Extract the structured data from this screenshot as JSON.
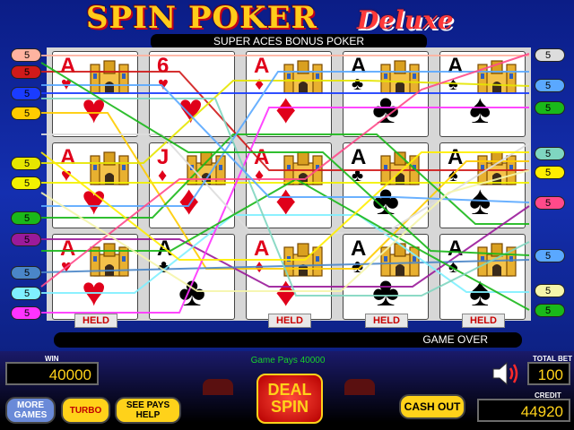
{
  "header": {
    "title_main": "SPIN POKER",
    "title_deluxe": "Deluxe",
    "game_name": "SUPER ACES BONUS POKER"
  },
  "colors": {
    "red_suit": "#e0001a",
    "black_suit": "#000000",
    "readout": "#ffd21a",
    "pays_text": "#19d22a"
  },
  "cards": [
    [
      {
        "rank": "A",
        "suit": "♥",
        "color": "red",
        "castle": true
      },
      {
        "rank": "6",
        "suit": "♥",
        "color": "red",
        "castle": false
      },
      {
        "rank": "A",
        "suit": "♦",
        "color": "red",
        "castle": true
      },
      {
        "rank": "A",
        "suit": "♣",
        "color": "black",
        "castle": true
      },
      {
        "rank": "A",
        "suit": "♠",
        "color": "black",
        "castle": true
      }
    ],
    [
      {
        "rank": "A",
        "suit": "♥",
        "color": "red",
        "castle": true
      },
      {
        "rank": "J",
        "suit": "♦",
        "color": "red",
        "castle": true
      },
      {
        "rank": "A",
        "suit": "♦",
        "color": "red",
        "castle": true
      },
      {
        "rank": "A",
        "suit": "♣",
        "color": "black",
        "castle": true
      },
      {
        "rank": "A",
        "suit": "♠",
        "color": "black",
        "castle": true
      }
    ],
    [
      {
        "rank": "A",
        "suit": "♥",
        "color": "red",
        "castle": true
      },
      {
        "rank": "A",
        "suit": "♣",
        "color": "black",
        "castle": false
      },
      {
        "rank": "A",
        "suit": "♦",
        "color": "red",
        "castle": true
      },
      {
        "rank": "A",
        "suit": "♣",
        "color": "black",
        "castle": true
      },
      {
        "rank": "A",
        "suit": "♠",
        "color": "black",
        "castle": true
      }
    ]
  ],
  "held_label": "HELD",
  "held_columns": [
    true,
    false,
    true,
    true,
    true
  ],
  "paylines": {
    "bet_label": "5",
    "left_colors": [
      "#ffb3a0",
      "#d01a1a",
      "#1a3cff",
      "#ffcc00",
      "#e6e600",
      "#f2f200",
      "#1ab81a",
      "#9a1a9a",
      "#4a86c8",
      "#7ff0ff",
      "#ff33ff"
    ],
    "right_colors": [
      "#dddddd",
      "#5aa8ff",
      "#1ab81a",
      "#7fd6c0",
      "#ffee00",
      "#ff4a8a",
      "#5aa8ff",
      "#f5f5aa",
      "#1ab81a"
    ]
  },
  "status": {
    "message": "GAME OVER",
    "pays": "Game Pays 40000"
  },
  "meters": {
    "win_label": "WIN",
    "win": "40000",
    "total_bet_label": "TOTAL BET",
    "total_bet": "100",
    "credit_label": "CREDIT",
    "credit": "44920"
  },
  "buttons": {
    "more_games": "MORE GAMES",
    "turbo": "TURBO",
    "see_pays": "SEE PAYS HELP",
    "deal_spin": "DEAL SPIN",
    "cash_out": "CASH OUT"
  },
  "icons": {
    "speaker": "speaker-icon",
    "castle": "castle-icon"
  }
}
